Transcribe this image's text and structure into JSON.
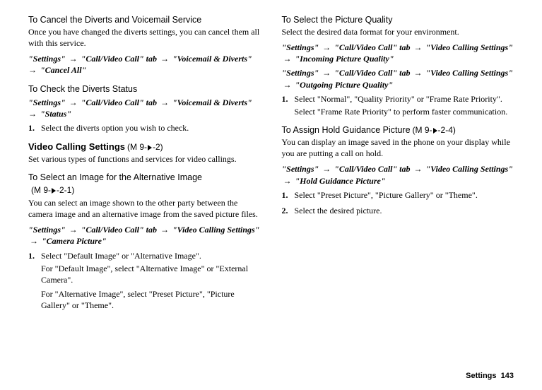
{
  "left": {
    "h1": "To Cancel the Diverts and Voicemail Service",
    "p1": "Once you have changed the diverts settings, you can cancel them all with this service.",
    "path1_a": "\"Settings\"",
    "path1_b": "\"Call/Video Call\" tab",
    "path1_c": "\"Voicemail & Diverts\"",
    "path1_d": "\"Cancel All\"",
    "h2": "To Check the Diverts Status",
    "path2_a": "\"Settings\"",
    "path2_b": "\"Call/Video Call\" tab",
    "path2_c": "\"Voicemail & Diverts\"",
    "path2_d": "\"Status\"",
    "step2_1_num": "1.",
    "step2_1": "Select the diverts option you wish to check.",
    "h3": "Video Calling Settings",
    "h3_code_prefix": " (M 9-",
    "h3_code_suffix": "-2)",
    "p3": "Set various types of functions and services for video callings.",
    "h4": "To Select an Image for the Alternative Image",
    "h4_code_prefix": " (M 9-",
    "h4_code_suffix": "-2-1)",
    "p4": "You can select an image shown to the other party between the camera image and an alternative image from the saved picture files.",
    "path4_a": "\"Settings\"",
    "path4_b": "\"Call/Video Call\" tab",
    "path4_c": "\"Video Calling Settings\"",
    "path4_d": "\"Camera Picture\"",
    "step4_1_num": "1.",
    "step4_1": "Select \"Default Image\" or \"Alternative Image\".",
    "step4_1_sub1": "For \"Default Image\", select \"Alternative Image\" or \"External Camera\".",
    "step4_1_sub2": "For \"Alternative Image\", select \"Preset Picture\", \"Picture Gallery\" or \"Theme\"."
  },
  "right": {
    "h1": "To Select the Picture Quality",
    "p1": "Select the desired data format for your environment.",
    "path1_a": "\"Settings\"",
    "path1_b": "\"Call/Video Call\" tab",
    "path1_c": "\"Video Calling Settings\"",
    "path1_d": "\"Incoming Picture Quality\"",
    "path2_a": "\"Settings\"",
    "path2_b": "\"Call/Video Call\" tab",
    "path2_c": "\"Video Calling Settings\"",
    "path2_d": "\"Outgoing Picture Quality\"",
    "step1_num": "1.",
    "step1": "Select \"Normal\", \"Quality Priority\" or \"Frame Rate Priority\".",
    "step1_sub": "Select \"Frame Rate Priority\" to perform faster communication.",
    "h2": "To Assign Hold Guidance Picture",
    "h2_code_prefix": " (M 9-",
    "h2_code_suffix": "-2-4)",
    "p2": "You can display an image saved in the phone on your display while you are putting a call on hold.",
    "path3_a": "\"Settings\"",
    "path3_b": "\"Call/Video Call\" tab",
    "path3_c": "\"Video Calling Settings\"",
    "path3_d": "\"Hold Guidance Picture\"",
    "step3_1_num": "1.",
    "step3_1": "Select \"Preset Picture\", \"Picture Gallery\" or \"Theme\".",
    "step3_2_num": "2.",
    "step3_2": "Select the desired picture."
  },
  "footer": {
    "label": "Settings",
    "page": "143"
  }
}
